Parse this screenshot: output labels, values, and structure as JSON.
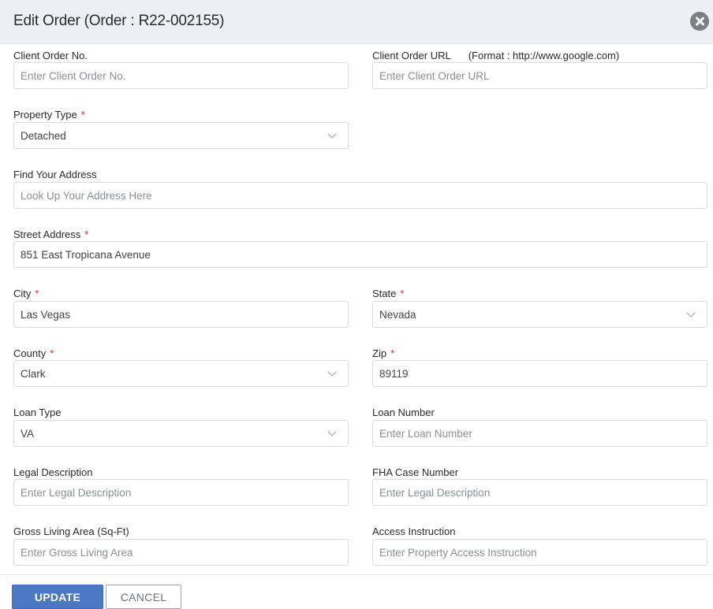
{
  "header": {
    "title": "Edit Order (Order : R22-002155)",
    "close_icon": "close-icon"
  },
  "form": {
    "client_order_no": {
      "label": "Client Order No.",
      "placeholder": "Enter Client Order No.",
      "value": ""
    },
    "client_order_url": {
      "label": "Client Order URL",
      "hint": "(Format : http://www.google.com)",
      "placeholder": "Enter Client Order URL",
      "value": ""
    },
    "property_type": {
      "label": "Property Type",
      "required": "*",
      "value": "Detached"
    },
    "find_address": {
      "label": "Find Your Address",
      "placeholder": "Look Up Your Address Here",
      "value": ""
    },
    "street_address": {
      "label": "Street Address",
      "required": "*",
      "value": "851 East Tropicana Avenue"
    },
    "city": {
      "label": "City",
      "required": "*",
      "value": "Las Vegas"
    },
    "state": {
      "label": "State",
      "required": "*",
      "value": "Nevada"
    },
    "county": {
      "label": "County",
      "required": "*",
      "value": "Clark"
    },
    "zip": {
      "label": "Zip",
      "required": "*",
      "value": "89119"
    },
    "loan_type": {
      "label": "Loan Type",
      "value": "VA"
    },
    "loan_number": {
      "label": "Loan Number",
      "placeholder": "Enter Loan Number",
      "value": ""
    },
    "legal_description": {
      "label": "Legal Description",
      "placeholder": "Enter Legal Description",
      "value": ""
    },
    "fha_case_number": {
      "label": "FHA Case Number",
      "placeholder": "Enter Legal Description",
      "value": ""
    },
    "gross_living_area": {
      "label": "Gross Living Area (Sq-Ft)",
      "placeholder": "Enter Gross Living Area",
      "value": ""
    },
    "access_instruction": {
      "label": "Access Instruction",
      "placeholder": "Enter Property Access Instruction",
      "value": ""
    }
  },
  "footer": {
    "update_label": "UPDATE",
    "cancel_label": "CANCEL"
  },
  "colors": {
    "header_bg": "#eef0f5",
    "required": "#e0262b",
    "primary_button": "#4a78c2"
  }
}
